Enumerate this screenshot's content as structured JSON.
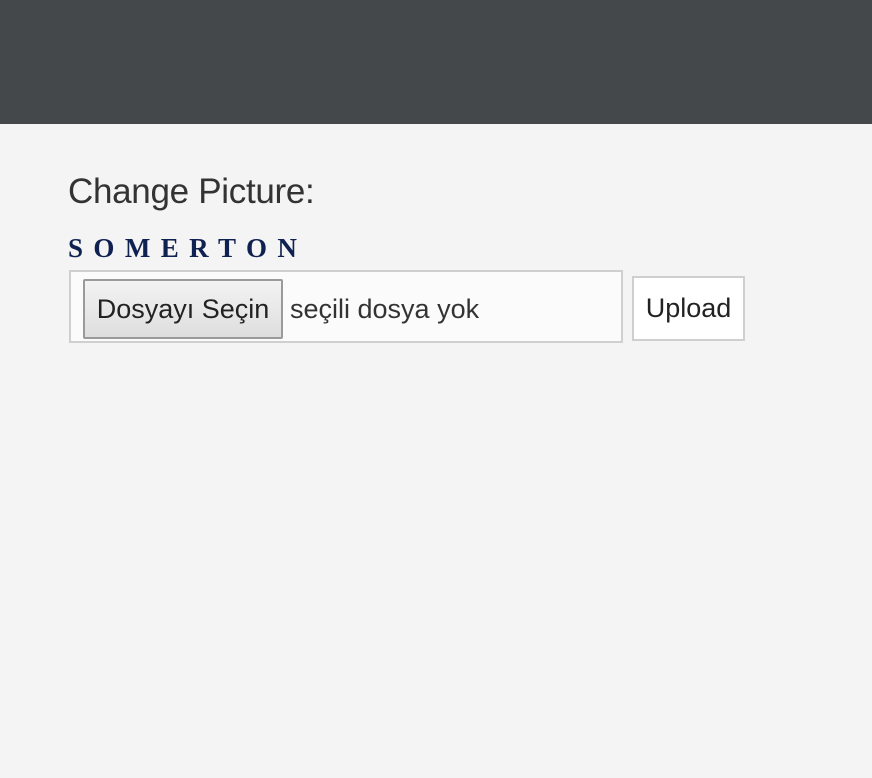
{
  "header": {
    "background_color": "#45484b"
  },
  "form": {
    "heading": "Change Picture:",
    "logo_text": "SOMERTON",
    "logo_color": "#0f2150",
    "file_input": {
      "button_label": "Dosyayı Seçin",
      "status_text": "seçili dosya yok"
    },
    "upload_label": "Upload"
  }
}
